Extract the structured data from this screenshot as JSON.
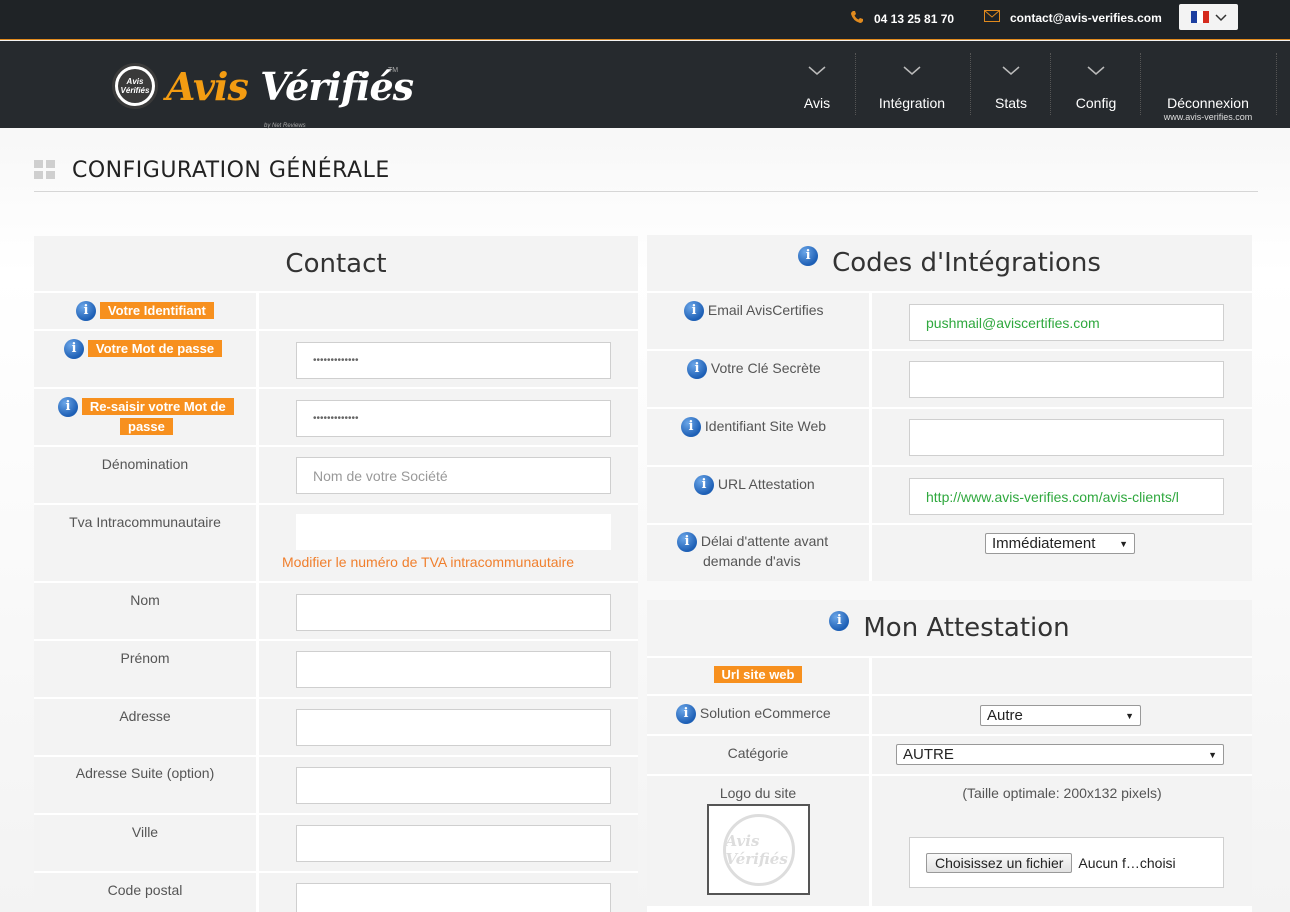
{
  "topbar": {
    "phone": "04 13 25 81 70",
    "email": "contact@avis-verifies.com",
    "language_flag": "fr-flag"
  },
  "logo": {
    "badge": "Avis Vérifiés",
    "part1": "Avis ",
    "part2": "Vérifiés",
    "tm": "TM",
    "byline": "by Net Reviews"
  },
  "nav": {
    "items": [
      {
        "label": "Avis"
      },
      {
        "label": "Intégration"
      },
      {
        "label": "Stats"
      },
      {
        "label": "Config"
      },
      {
        "label": "Déconnexion",
        "sub": "www.avis-verifies.com"
      }
    ]
  },
  "page": {
    "title": "CONFIGURATION GÉNÉRALE"
  },
  "contact": {
    "title": "Contact",
    "identifiant_label": "Votre Identifiant",
    "password_label": "Votre Mot de passe",
    "password_value": "•••••••••••••",
    "repassword_label_1": "Re-saisir votre Mot de",
    "repassword_label_2": "passe",
    "repassword_value": "•••••••••••••",
    "denomination_label": "Dénomination",
    "denomination_placeholder": "Nom de votre Société",
    "tva_label": "Tva Intracommunautaire",
    "tva_link": "Modifier le numéro de TVA intracommunautaire",
    "nom_label": "Nom",
    "prenom_label": "Prénom",
    "adresse_label": "Adresse",
    "adresse2_label": "Adresse Suite (option)",
    "ville_label": "Ville",
    "cp_label": "Code postal"
  },
  "codes": {
    "title": "Codes d'Intégrations",
    "email_label": "Email AvisCertifies",
    "email_value": "pushmail@aviscertifies.com",
    "secret_label": "Votre Clé Secrète",
    "site_id_label": "Identifiant Site Web",
    "url_label": "URL Attestation",
    "url_value": "http://www.avis-verifies.com/avis-clients/l",
    "delay_label_1": "Délai d'attente avant",
    "delay_label_2": "demande d'avis",
    "delay_value": "Immédiatement"
  },
  "attestation": {
    "title": "Mon Attestation",
    "url_label": "Url site web",
    "ecommerce_label": "Solution eCommerce",
    "ecommerce_value": "Autre",
    "categorie_label": "Catégorie",
    "categorie_value": "AUTRE",
    "logo_label": "Logo du site",
    "logo_hint": "(Taille optimale: 200x132 pixels)",
    "file_button": "Choisissez un fichier",
    "file_status": "Aucun f…choisi"
  },
  "colors": {
    "orange": "#f7901e",
    "green_text": "#2fa83e",
    "header_dark": "#262a2e",
    "info_blue": "#1d5fb5"
  }
}
